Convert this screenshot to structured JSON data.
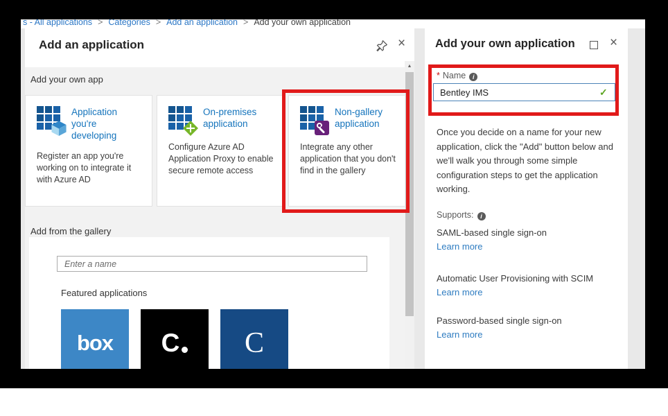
{
  "breadcrumb": {
    "separator": ">",
    "items": [
      {
        "label": "s - All applications",
        "type": "link"
      },
      {
        "label": "Categories",
        "type": "link"
      },
      {
        "label": "Add an application",
        "type": "link"
      },
      {
        "label": "Add your own application",
        "type": "current"
      }
    ]
  },
  "icons": {
    "close": "×",
    "info": "i",
    "check": "✓",
    "scroll_up": "▲"
  },
  "left_blade": {
    "title": "Add an application",
    "own_app_section_label": "Add your own app",
    "tiles": [
      {
        "title": "Application you're developing",
        "description": "Register an app you're working on to integrate it with Azure AD",
        "badge_icon": "cube-icon"
      },
      {
        "title": "On-premises application",
        "description": "Configure Azure AD Application Proxy to enable secure remote access",
        "badge_icon": "proxy-arrows-icon"
      },
      {
        "title": "Non-gallery application",
        "description": "Integrate any other application that you don't find in the gallery",
        "badge_icon": "wrench-icon"
      }
    ],
    "gallery_section_label": "Add from the gallery",
    "search_placeholder": "Enter a name",
    "featured_label": "Featured applications",
    "featured_apps": [
      {
        "name": "box",
        "logo_text": "box",
        "bg": "#3d87c6"
      },
      {
        "name": "concur",
        "logo_text": "C",
        "bg": "#000000"
      },
      {
        "name": "cornerstone",
        "logo_text": "C",
        "bg": "#164a84"
      }
    ]
  },
  "right_blade": {
    "title": "Add your own application",
    "name_field": {
      "required_marker": "*",
      "label": "Name",
      "value": "Bentley IMS",
      "valid": true
    },
    "description": "Once you decide on a name for your new application, click the \"Add\" button below and we'll walk you through some simple configuration steps to get the application working.",
    "supports_label": "Supports:",
    "supports": [
      {
        "name": "SAML-based single sign-on",
        "link": "Learn more"
      },
      {
        "name": "Automatic User Provisioning with SCIM",
        "link": "Learn more"
      },
      {
        "name": "Password-based single sign-on",
        "link": "Learn more"
      }
    ]
  },
  "colors": {
    "highlight_red": "#e11a1a",
    "link_blue": "#2b76c4",
    "tile_title_blue": "#1574bc",
    "valid_green": "#5da522",
    "box_brand": "#3d87c6",
    "concur_brand": "#000000",
    "cornerstone_brand": "#164a84"
  }
}
